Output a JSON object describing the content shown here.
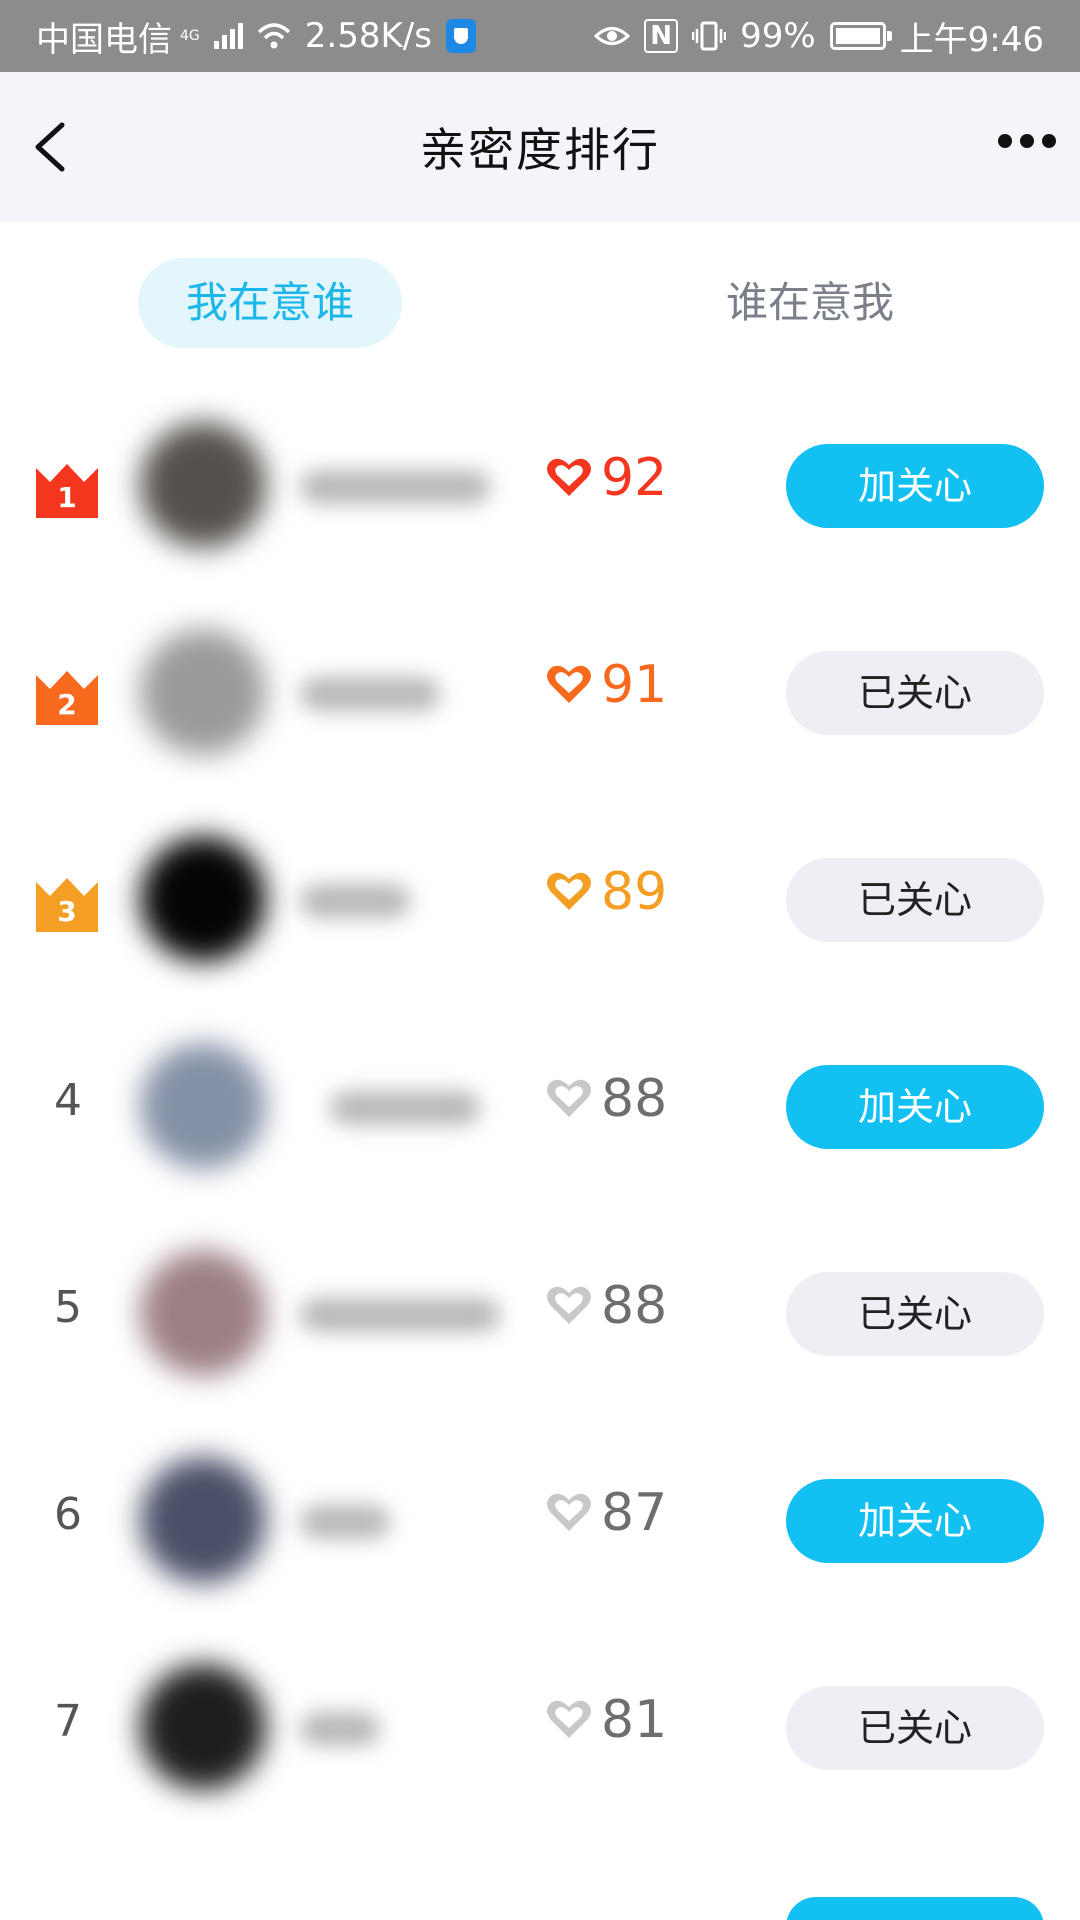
{
  "status_bar": {
    "carrier": "中国电信",
    "network": "4G",
    "speed": "2.58K/s",
    "battery": "99%",
    "time": "上午9:46"
  },
  "header": {
    "title": "亲密度排行"
  },
  "tabs": [
    {
      "label": "我在意谁",
      "active": true
    },
    {
      "label": "谁在意我",
      "active": false
    }
  ],
  "colors": {
    "accent": "#12c0f2",
    "rank1": "#f5361f",
    "rank2": "#f76a1d",
    "rank3": "#f59e24",
    "gray_heart": "#c8c8c8"
  },
  "ranking": [
    {
      "rank": "1",
      "score": "92",
      "action": "加关心",
      "followed": false
    },
    {
      "rank": "2",
      "score": "91",
      "action": "已关心",
      "followed": true
    },
    {
      "rank": "3",
      "score": "89",
      "action": "已关心",
      "followed": true
    },
    {
      "rank": "4",
      "score": "88",
      "action": "加关心",
      "followed": false
    },
    {
      "rank": "5",
      "score": "88",
      "action": "已关心",
      "followed": true
    },
    {
      "rank": "6",
      "score": "87",
      "action": "加关心",
      "followed": false
    },
    {
      "rank": "7",
      "score": "81",
      "action": "已关心",
      "followed": true
    }
  ]
}
